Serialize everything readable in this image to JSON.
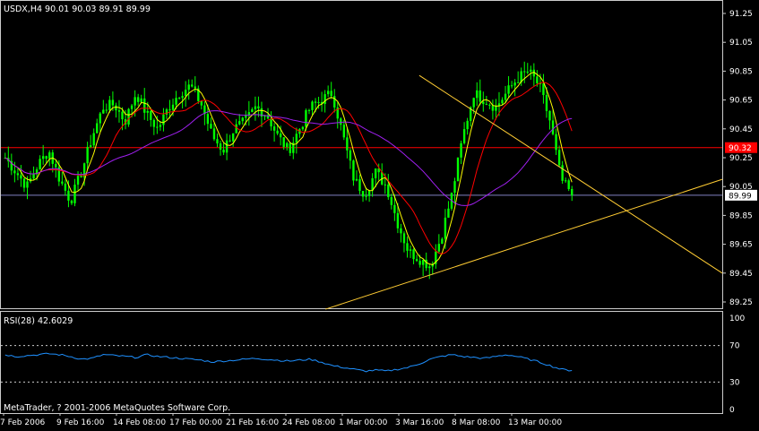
{
  "header": {
    "symbol_line": "USDX,H4  90.01 90.03 89.91 89.99",
    "rsi_line": "RSI(28) 42.6029",
    "copyright": "MetaTrader, ? 2001-2006 MetaQuotes Software Corp."
  },
  "colors": {
    "background": "#000000",
    "border": "#cccccc",
    "candles": "#00ff00",
    "fast_ma": "#ffff00",
    "medium_ma": "#ff0000",
    "slow_ma": "#a020f0",
    "horizontal_level": "#ff0000",
    "current_price_line": "#8080c0",
    "trendlines": "#ffcc33",
    "rsi_line": "#1e90ff",
    "rsi_levels": "#cccccc"
  },
  "chart_data": [
    {
      "type": "candlestick",
      "title": "USDX,H4",
      "ohlc_current": {
        "open": 90.01,
        "high": 90.03,
        "low": 89.91,
        "close": 89.99
      },
      "ylim": [
        89.15,
        91.3
      ],
      "y_ticks": [
        "91.25",
        "91.05",
        "90.85",
        "90.65",
        "90.45",
        "90.25",
        "90.05",
        "89.85",
        "89.65",
        "89.45",
        "89.25"
      ],
      "x_ticks": [
        "7 Feb 2006",
        "9 Feb 16:00",
        "14 Feb 08:00",
        "17 Feb 00:00",
        "21 Feb 16:00",
        "24 Feb 08:00",
        "1 Mar 00:00",
        "3 Mar 16:00",
        "8 Mar 08:00",
        "13 Mar 00:00"
      ],
      "price_labels": {
        "level": "90.32",
        "current": "89.99"
      },
      "horizontal_level": 90.32,
      "current_price": 89.99,
      "close_path": [
        90.25,
        90.15,
        90.05,
        90.2,
        90.3,
        90.1,
        89.95,
        90.15,
        90.4,
        90.6,
        90.62,
        90.5,
        90.7,
        90.55,
        90.45,
        90.6,
        90.7,
        90.75,
        90.62,
        90.4,
        90.3,
        90.45,
        90.5,
        90.6,
        90.55,
        90.4,
        90.3,
        90.45,
        90.6,
        90.65,
        90.7,
        90.4,
        90.1,
        90.0,
        90.15,
        90.05,
        89.8,
        89.6,
        89.55,
        89.5,
        89.7,
        90.0,
        90.4,
        90.7,
        90.65,
        90.6,
        90.7,
        90.8,
        90.85,
        90.75,
        90.5,
        90.1,
        89.99
      ],
      "trendline_support": [
        [
          0.45,
          89.2
        ],
        [
          1.0,
          90.1
        ]
      ],
      "trendline_resistance": [
        [
          0.58,
          90.82
        ],
        [
          1.0,
          89.45
        ]
      ]
    },
    {
      "type": "line",
      "title": "RSI(28) 42.6029",
      "ylim": [
        0,
        100
      ],
      "levels": [
        70,
        30
      ],
      "y_ticks": [
        "100",
        "70",
        "30",
        "0"
      ],
      "values": [
        60,
        58,
        59,
        60,
        61,
        60,
        58,
        55,
        56,
        60,
        59,
        58,
        57,
        60,
        58,
        57,
        56,
        55,
        54,
        52,
        53,
        54,
        55,
        56,
        55,
        54,
        53,
        54,
        55,
        52,
        48,
        46,
        44,
        42,
        43,
        42,
        44,
        46,
        50,
        55,
        58,
        60,
        58,
        57,
        56,
        58,
        60,
        58,
        55,
        52,
        48,
        44,
        42.6
      ]
    }
  ]
}
